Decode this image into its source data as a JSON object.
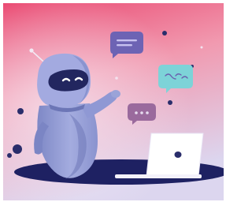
{
  "scene": {
    "description_icons": [
      "robot-mascot",
      "laptop-icon",
      "chat-bubble-icon"
    ],
    "colors": {
      "bg_top": "#e9456e",
      "bg_mid": "#f2a0b5",
      "bg_bottom": "#d9d3ee",
      "robot_body": "#9aa3d8",
      "robot_shadow": "#6f79b8",
      "robot_visor": "#2a2d6b",
      "navy": "#1f2366",
      "bubble_purple": "#6d63b4",
      "bubble_teal": "#7dd3d8",
      "bubble_mauve": "#a26b9b",
      "laptop": "#ffffff"
    }
  }
}
